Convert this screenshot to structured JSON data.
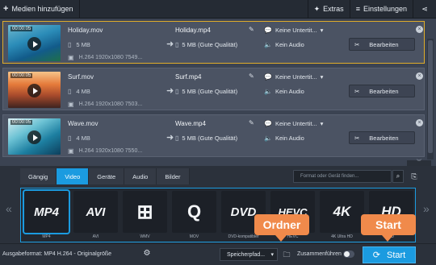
{
  "toolbar": {
    "add_label": "Medien hinzufügen",
    "extras_label": "Extras",
    "settings_label": "Einstellungen"
  },
  "files": [
    {
      "time": "00:00:05",
      "source_name": "Holiday.mov",
      "source_size": "5 MB",
      "codec": "H.264 1920x1080 7549...",
      "output_name": "Holiday.mp4",
      "output_size": "5 MB (Gute Qualität)",
      "subtitles": "Keine Untertit...",
      "audio": "Kein Audio",
      "edit_label": "Bearbeiten"
    },
    {
      "time": "00:00:05",
      "source_name": "Surf.mov",
      "source_size": "4 MB",
      "codec": "H.264 1920x1080 7503...",
      "output_name": "Surf.mp4",
      "output_size": "5 MB (Gute Qualität)",
      "subtitles": "Keine Untertit...",
      "audio": "Kein Audio",
      "edit_label": "Bearbeiten"
    },
    {
      "time": "00:00:05",
      "source_name": "Wave.mov",
      "source_size": "4 MB",
      "codec": "H.264 1920x1080 7550...",
      "output_name": "Wave.mp4",
      "output_size": "5 MB (Gute Qualität)",
      "subtitles": "Keine Untertit...",
      "audio": "Kein Audio",
      "edit_label": "Bearbeiten"
    }
  ],
  "tabs": [
    "Gängig",
    "Video",
    "Geräte",
    "Audio",
    "Bilder"
  ],
  "search_placeholder": "Format oder Gerät finden...",
  "formats": [
    {
      "logo": "MP4",
      "label": "MP4"
    },
    {
      "logo": "AVI",
      "label": "AVI"
    },
    {
      "logo": "⊞",
      "label": "WMV"
    },
    {
      "logo": "Q",
      "label": "MOV"
    },
    {
      "logo": "DVD",
      "label": "DVD-kompatibler"
    },
    {
      "logo": "HEVC",
      "label": "HEVC"
    },
    {
      "logo": "4K",
      "label": "4K Ultra HD"
    },
    {
      "logo": "HD",
      "label": "HD"
    }
  ],
  "bottom": {
    "output_format": "Ausgabeformat: MP4 H.264 - Originalgröße",
    "save_path": "Speicherpfad...",
    "merge_label": "Zusammenführen",
    "start_label": "Start"
  },
  "callouts": {
    "folder": "Ordner",
    "start": "Start"
  },
  "colors": {
    "accent": "#1b9be0",
    "callout": "#f08a4b",
    "selected_border": "#e0ac2a"
  }
}
